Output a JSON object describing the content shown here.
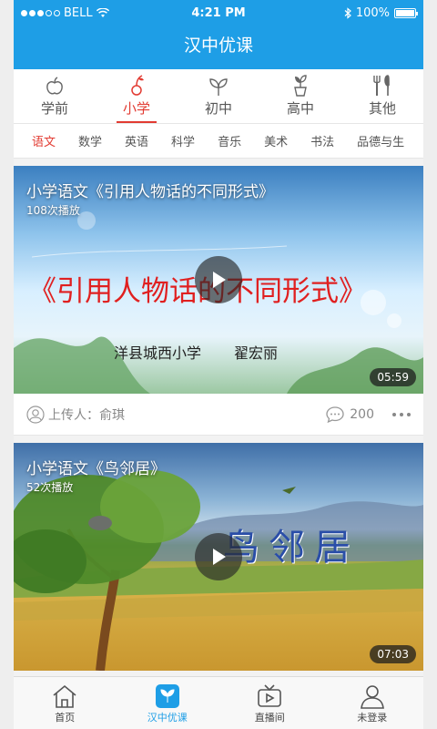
{
  "status_bar": {
    "carrier": "BELL",
    "time": "4:21 PM",
    "battery": "100%",
    "battery_level": 1.0
  },
  "app_title": "汉中优课",
  "levels": [
    {
      "label": "学前",
      "icon": "apple-icon",
      "active": false
    },
    {
      "label": "小学",
      "icon": "cherry-icon",
      "active": true
    },
    {
      "label": "初中",
      "icon": "sprout-icon",
      "active": false
    },
    {
      "label": "高中",
      "icon": "potted-plant-icon",
      "active": false
    },
    {
      "label": "其他",
      "icon": "utensils-icon",
      "active": false
    }
  ],
  "subjects": [
    {
      "label": "语文",
      "active": true
    },
    {
      "label": "数学",
      "active": false
    },
    {
      "label": "英语",
      "active": false
    },
    {
      "label": "科学",
      "active": false
    },
    {
      "label": "音乐",
      "active": false
    },
    {
      "label": "美术",
      "active": false
    },
    {
      "label": "书法",
      "active": false
    },
    {
      "label": "品德与生",
      "active": false
    }
  ],
  "videos": [
    {
      "title": "小学语文《引用人物话的不同形式》",
      "plays": "108次播放",
      "duration": "05:59",
      "thumb_main": "《引用人物话的不同形式》",
      "thumb_school": "洋县城西小学",
      "thumb_teacher": "翟宏丽",
      "uploader_label": "上传人：俞琪",
      "comments": "200"
    },
    {
      "title": "小学语文《鸟邻居》",
      "plays": "52次播放",
      "duration": "07:03",
      "thumb_main": "鸟邻居"
    }
  ],
  "tabs": [
    {
      "label": "首页",
      "icon": "home-icon",
      "active": false
    },
    {
      "label": "汉中优课",
      "icon": "app-logo-icon",
      "active": true
    },
    {
      "label": "直播间",
      "icon": "tv-icon",
      "active": false
    },
    {
      "label": "未登录",
      "icon": "user-icon",
      "active": false
    }
  ],
  "colors": {
    "brand": "#1e9ee6",
    "active": "#e23b32"
  }
}
